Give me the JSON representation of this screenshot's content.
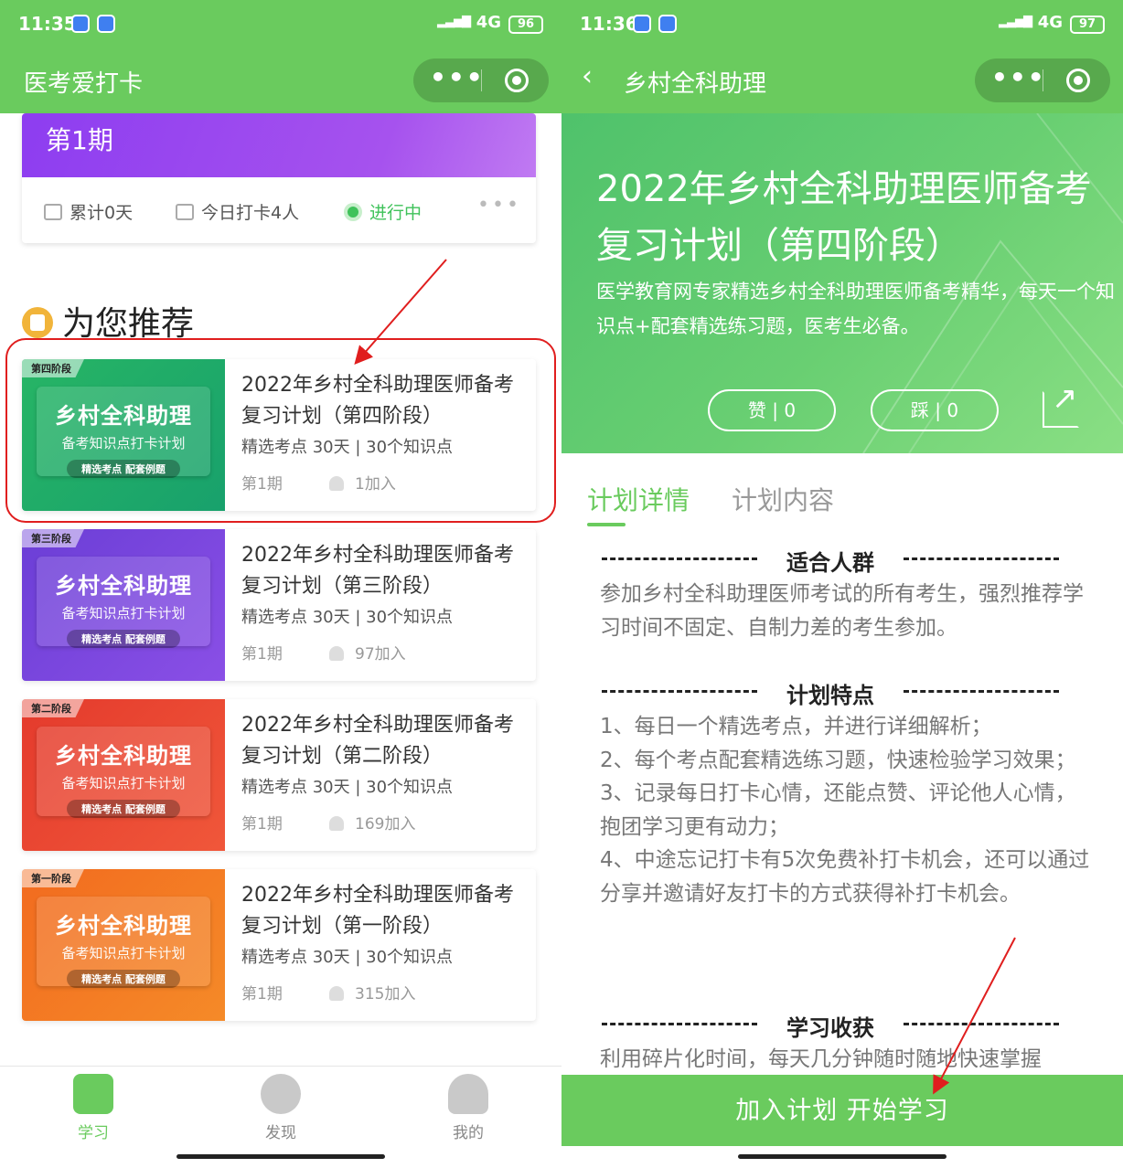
{
  "left": {
    "status": {
      "time": "11:35",
      "network": "4G",
      "battery": "96"
    },
    "title": "医考爱打卡",
    "period_card": {
      "banner": "第1期",
      "accum": "累计0天",
      "today": "今日打卡4人",
      "state": "进行中"
    },
    "rec_title": "为您推荐",
    "courses": [
      {
        "stage": "第四阶段",
        "thumb_title": "乡村全科助理",
        "thumb_sub": "备考知识点打卡计划",
        "pill": "精选考点  配套例题",
        "name": "2022年乡村全科助理医师备考复习计划（第四阶段）",
        "meta": "精选考点  30天 | 30个知识点",
        "period": "第1期",
        "joined": "1加入",
        "color_from": "#27b565",
        "color_to": "#18a16c"
      },
      {
        "stage": "第三阶段",
        "thumb_title": "乡村全科助理",
        "thumb_sub": "备考知识点打卡计划",
        "pill": "精选考点  配套例题",
        "name": "2022年乡村全科助理医师备考复习计划（第三阶段）",
        "meta": "精选考点  30天 | 30个知识点",
        "period": "第1期",
        "joined": "97加入",
        "color_from": "#6b3ed6",
        "color_to": "#8a4fe6"
      },
      {
        "stage": "第二阶段",
        "thumb_title": "乡村全科助理",
        "thumb_sub": "备考知识点打卡计划",
        "pill": "精选考点  配套例题",
        "name": "2022年乡村全科助理医师备考复习计划（第二阶段）",
        "meta": "精选考点  30天 | 30个知识点",
        "period": "第1期",
        "joined": "169加入",
        "color_from": "#e43a2c",
        "color_to": "#f0573a"
      },
      {
        "stage": "第一阶段",
        "thumb_title": "乡村全科助理",
        "thumb_sub": "备考知识点打卡计划",
        "pill": "精选考点  配套例题",
        "name": "2022年乡村全科助理医师备考复习计划（第一阶段）",
        "meta": "精选考点  30天 | 30个知识点",
        "period": "第1期",
        "joined": "315加入",
        "color_from": "#f26b1f",
        "color_to": "#f58a28"
      }
    ],
    "tabs": [
      "学习",
      "发现",
      "我的"
    ]
  },
  "right": {
    "status": {
      "time": "11:36",
      "network": "4G",
      "battery": "97"
    },
    "title": "乡村全科助理",
    "hero": {
      "title": "2022年乡村全科助理医师备考复习计划（第四阶段）",
      "desc": "医学教育网专家精选乡村全科助理医师备考精华，每天一个知识点+配套精选练习题，医考生必备。",
      "like": "赞 | 0",
      "dislike": "踩 | 0"
    },
    "tabs": [
      "计划详情",
      "计划内容"
    ],
    "sections": [
      {
        "head": "适合人群",
        "body": "参加乡村全科助理医师考试的所有考生，强烈推荐学习时间不固定、自制力差的考生参加。"
      },
      {
        "head": "计划特点",
        "body": "1、每日一个精选考点，并进行详细解析；\n2、每个考点配套精选练习题，快速检验学习效果；\n3、记录每日打卡心情，还能点赞、评论他人心情，抱团学习更有动力；\n4、中途忘记打卡有5次免费补打卡机会，还可以通过分享并邀请好友打卡的方式获得补打卡机会。"
      },
      {
        "head": "学习收获",
        "body": "利用碎片化时间，每天几分钟随时随地快速掌握"
      }
    ],
    "cta": "加入计划 开始学习"
  },
  "colors": {
    "brand_green": "#6acb5e",
    "annotation_red": "#e01e1e"
  }
}
